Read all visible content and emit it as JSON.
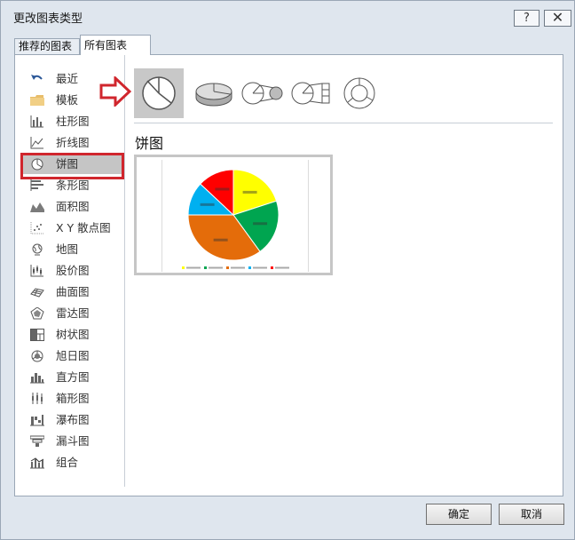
{
  "window": {
    "title": "更改图表类型",
    "help_label": "?",
    "close_label": "✕"
  },
  "tabs": [
    {
      "label": "推荐的图表"
    },
    {
      "label": "所有图表"
    }
  ],
  "sidebar": {
    "items": [
      {
        "label": "最近",
        "icon": "undo-arrow-icon"
      },
      {
        "label": "模板",
        "icon": "folder-icon"
      },
      {
        "label": "柱形图",
        "icon": "column-chart-icon"
      },
      {
        "label": "折线图",
        "icon": "line-chart-icon"
      },
      {
        "label": "饼图",
        "icon": "pie-chart-icon",
        "selected": true
      },
      {
        "label": "条形图",
        "icon": "bar-chart-icon"
      },
      {
        "label": "面积图",
        "icon": "area-chart-icon"
      },
      {
        "label": "X Y 散点图",
        "icon": "scatter-chart-icon"
      },
      {
        "label": "地图",
        "icon": "globe-icon"
      },
      {
        "label": "股价图",
        "icon": "stock-chart-icon"
      },
      {
        "label": "曲面图",
        "icon": "surface-chart-icon"
      },
      {
        "label": "雷达图",
        "icon": "radar-chart-icon"
      },
      {
        "label": "树状图",
        "icon": "treemap-icon"
      },
      {
        "label": "旭日图",
        "icon": "sunburst-icon"
      },
      {
        "label": "直方图",
        "icon": "histogram-icon"
      },
      {
        "label": "箱形图",
        "icon": "box-whisker-icon"
      },
      {
        "label": "瀑布图",
        "icon": "waterfall-icon"
      },
      {
        "label": "漏斗图",
        "icon": "funnel-icon"
      },
      {
        "label": "组合",
        "icon": "combo-chart-icon"
      }
    ]
  },
  "content": {
    "subtypes": [
      {
        "icon": "pie-icon",
        "selected": true
      },
      {
        "icon": "pie-3d-icon"
      },
      {
        "icon": "pie-of-pie-icon"
      },
      {
        "icon": "bar-of-pie-icon"
      },
      {
        "icon": "doughnut-icon"
      }
    ],
    "heading": "饼图"
  },
  "chart_data": {
    "type": "pie",
    "values": [
      20,
      20,
      35,
      12,
      13
    ],
    "colors": [
      "#ffff00",
      "#00a550",
      "#e46c0a",
      "#00b0f0",
      "#ff0000"
    ]
  },
  "footer": {
    "ok_label": "确定",
    "cancel_label": "取消"
  },
  "colors": {
    "highlight_red": "#d0262d",
    "selected_gray": "#c5c5c5"
  }
}
